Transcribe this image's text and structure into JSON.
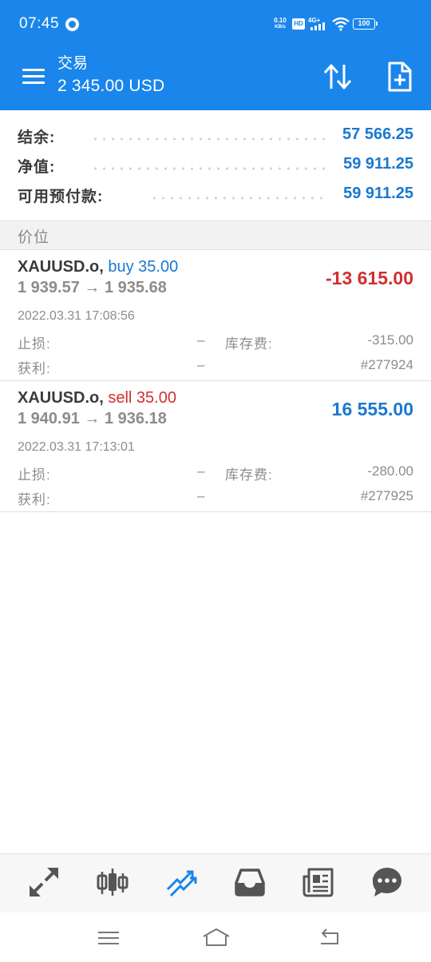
{
  "status_bar": {
    "time": "07:45",
    "net_speed_value": "0.10",
    "net_speed_unit": "KB/s",
    "hd_badge": "HD",
    "network_type": "4G+",
    "battery_level": "100"
  },
  "app_bar": {
    "title": "交易",
    "subtitle": "2 345.00 USD",
    "icons": [
      "menu-icon",
      "sort-icon",
      "new-order-icon"
    ]
  },
  "summary": {
    "rows": [
      {
        "label": "结余:",
        "value": "57 566.25"
      },
      {
        "label": "净值:",
        "value": "59 911.25"
      },
      {
        "label": "可用预付款:",
        "value": "59 911.25"
      }
    ]
  },
  "section": {
    "title": "价位"
  },
  "positions": [
    {
      "symbol": "XAUUSD.o,",
      "type": "buy 35.00",
      "prices": "1 939.57 → 1 935.68",
      "profit": "-13 615.00",
      "time": "2022.03.31 17:08:56",
      "sl_label": "止损:",
      "sl_value": "–",
      "swap_label": "库存费:",
      "swap_value": "-315.00",
      "tp_label": "获利:",
      "tp_value": "–",
      "ticket": "#277924"
    },
    {
      "symbol": "XAUUSD.o,",
      "type": "sell 35.00",
      "prices": "1 940.91 → 1 936.18",
      "profit": "16 555.00",
      "time": "2022.03.31 17:13:01",
      "sl_label": "止损:",
      "sl_value": "–",
      "swap_label": "库存费:",
      "swap_value": "-280.00",
      "tp_label": "获利:",
      "tp_value": "–",
      "ticket": "#277925"
    }
  ],
  "colors": {
    "accent": "#1a86eb",
    "profit_positive": "#1a78d0",
    "profit_negative": "#d12f2f"
  },
  "bottom_nav": {
    "items": [
      "quotes-icon",
      "chart-icon",
      "trade-icon",
      "history-icon",
      "news-icon",
      "chat-icon"
    ],
    "active": "trade-icon"
  },
  "system_nav": {
    "items": [
      "recents-icon",
      "home-icon",
      "back-icon"
    ]
  }
}
